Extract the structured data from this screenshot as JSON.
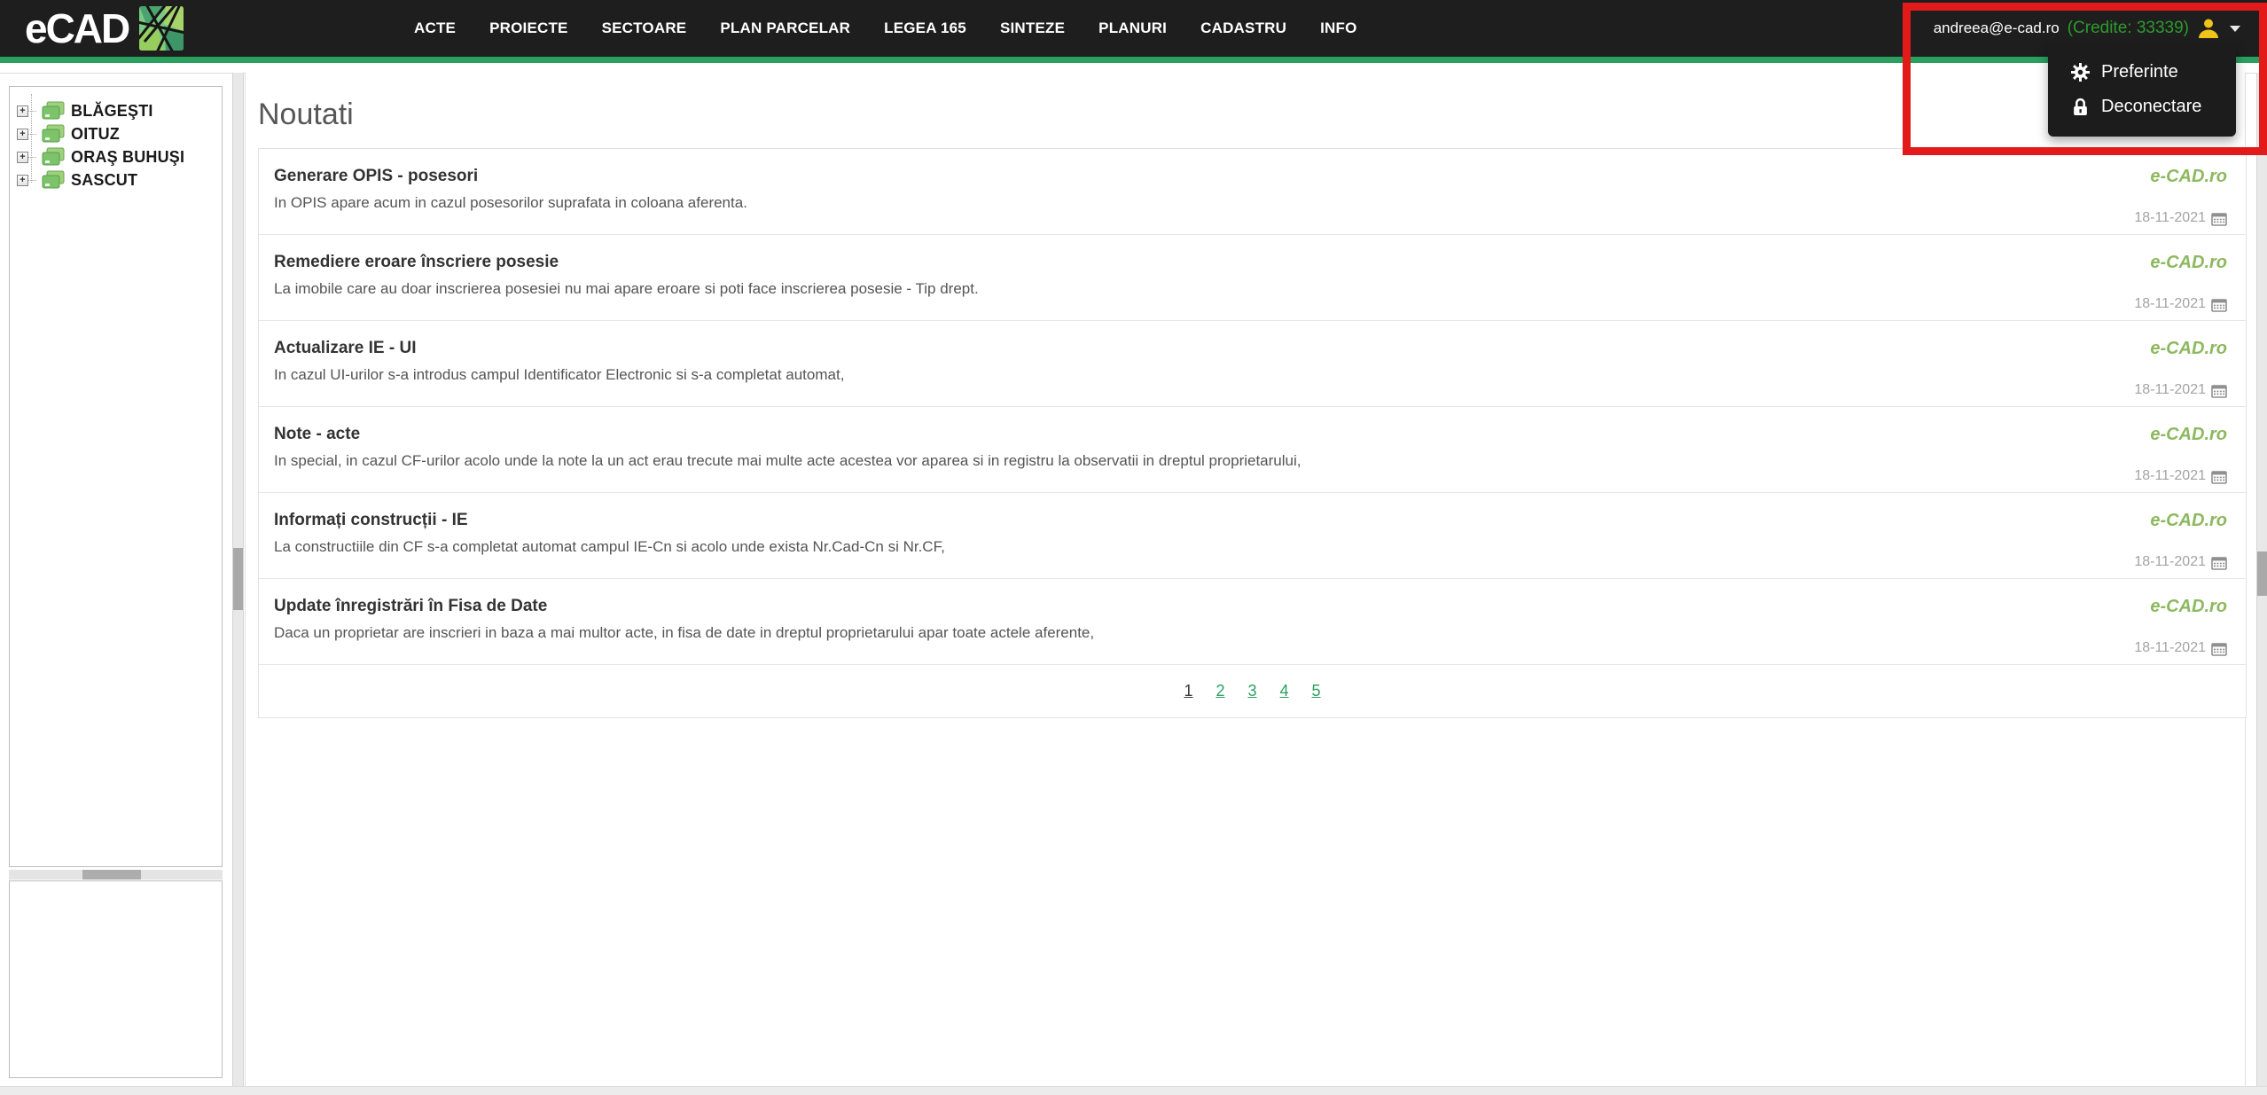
{
  "navbar": {
    "brand": "eCAD",
    "items": [
      "ACTE",
      "PROIECTE",
      "SECTOARE",
      "PLAN PARCELAR",
      "LEGEA 165",
      "SINTEZE",
      "PLANURI",
      "CADASTRU",
      "INFO"
    ],
    "user_email": "andreea@e-cad.ro",
    "credits_label": "(Credite: 33339)"
  },
  "user_menu": {
    "items": [
      {
        "icon": "gear-icon",
        "label": "Preferinte"
      },
      {
        "icon": "lock-icon",
        "label": "Deconectare"
      }
    ]
  },
  "sidebar": {
    "tree": [
      {
        "label": "BLĂGEŞTI"
      },
      {
        "label": "OITUZ"
      },
      {
        "label": "ORAŞ BUHUŞI"
      },
      {
        "label": "SASCUT"
      }
    ]
  },
  "main": {
    "title": "Noutati",
    "news": [
      {
        "title": "Generare OPIS - posesori",
        "desc": "In OPIS apare acum in cazul posesorilor suprafata in coloana aferenta.",
        "source": "e-CAD.ro",
        "date": "18-11-2021"
      },
      {
        "title": "Remediere eroare înscriere posesie",
        "desc": "La imobile care au doar inscrierea posesiei nu mai apare eroare si poti face inscrierea posesie - Tip drept.",
        "source": "e-CAD.ro",
        "date": "18-11-2021"
      },
      {
        "title": "Actualizare IE - UI",
        "desc": "In cazul UI-urilor s-a introdus campul Identificator Electronic si s-a completat automat,",
        "source": "e-CAD.ro",
        "date": "18-11-2021"
      },
      {
        "title": "Note - acte",
        "desc": "In special, in cazul CF-urilor acolo unde la note la un act erau trecute mai multe acte acestea vor aparea si in registru la observatii in dreptul proprietarului,",
        "source": "e-CAD.ro",
        "date": "18-11-2021"
      },
      {
        "title": "Informați construcții - IE",
        "desc": "La constructiile din CF s-a completat automat campul IE-Cn si acolo unde exista Nr.Cad-Cn si Nr.CF,",
        "source": "e-CAD.ro",
        "date": "18-11-2021"
      },
      {
        "title": "Update înregistrări în Fisa de Date",
        "desc": "Daca un proprietar are inscrieri in baza a mai multor acte, in fisa de date in dreptul proprietarului apar toate actele aferente,",
        "source": "e-CAD.ro",
        "date": "18-11-2021"
      }
    ],
    "pagination": {
      "current": "1",
      "pages": [
        "1",
        "2",
        "3",
        "4",
        "5"
      ]
    }
  },
  "colors": {
    "accent_green": "#2aa05f",
    "credits_green": "#2d9b2d",
    "source_green": "#8cb85e",
    "user_icon_gold": "#f0c419",
    "annotation_red": "#e21a1a",
    "navbar_bg": "#1e1e1e"
  }
}
